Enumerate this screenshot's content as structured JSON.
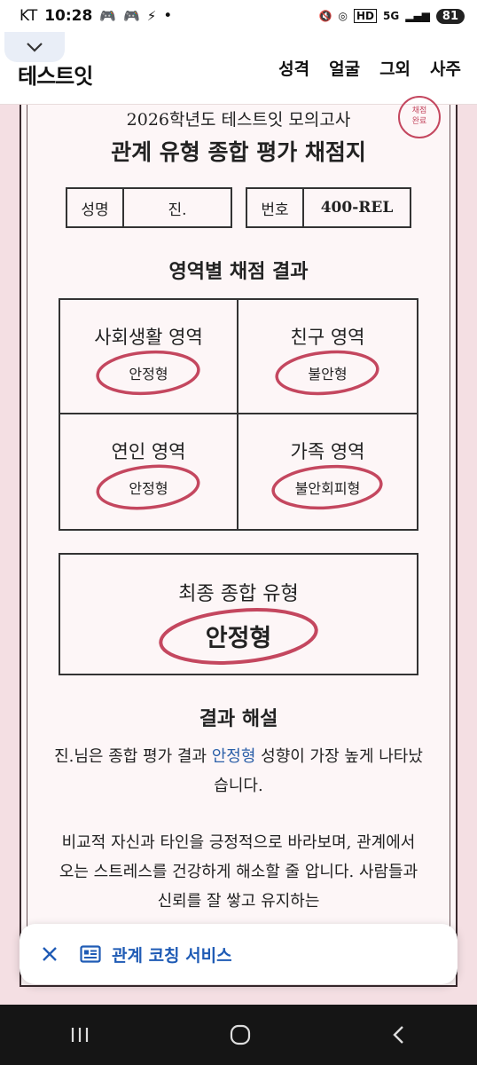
{
  "status_bar": {
    "carrier": "KT",
    "time": "10:28",
    "hd": "HD",
    "network": "5G",
    "battery": "81"
  },
  "header": {
    "logo": "테스트잇",
    "nav": [
      "성격",
      "얼굴",
      "그외",
      "사주"
    ]
  },
  "sheet": {
    "exam_title": "2026학년도 테스트잇 모의고사",
    "title": "관계 유형 종합 평가 채점지",
    "stamp": [
      "채점",
      "완료"
    ],
    "name_label": "성명",
    "name_value": "진.",
    "number_label": "번호",
    "number_value": "400-REL"
  },
  "results": {
    "title": "영역별 채점 결과",
    "areas": [
      {
        "name": "사회생활 영역",
        "result": "안정형"
      },
      {
        "name": "친구 영역",
        "result": "불안형"
      },
      {
        "name": "연인 영역",
        "result": "안정형"
      },
      {
        "name": "가족 영역",
        "result": "불안회피형"
      }
    ],
    "final_label": "최종 종합 유형",
    "final_result": "안정형"
  },
  "explanation": {
    "title": "결과 해설",
    "p1_prefix": "진.님은 종합 평가 결과 ",
    "p1_highlight": "안정형",
    "p1_suffix": " 성향이 가장 높게 나타났습니다.",
    "p2": "비교적 자신과 타인을 긍정적으로 바라보며, 관계에서 오는 스트레스를 건강하게 해소할 줄 압니다. 사람들과 신뢰를 잘 쌓고 유지하는"
  },
  "service_bar": {
    "label": "관계 코칭 서비스"
  },
  "colors": {
    "ring": "#c4475f",
    "accent_blue": "#1f5bb5",
    "paper": "#fdf6f7",
    "page_bg": "#f4dfe3"
  }
}
